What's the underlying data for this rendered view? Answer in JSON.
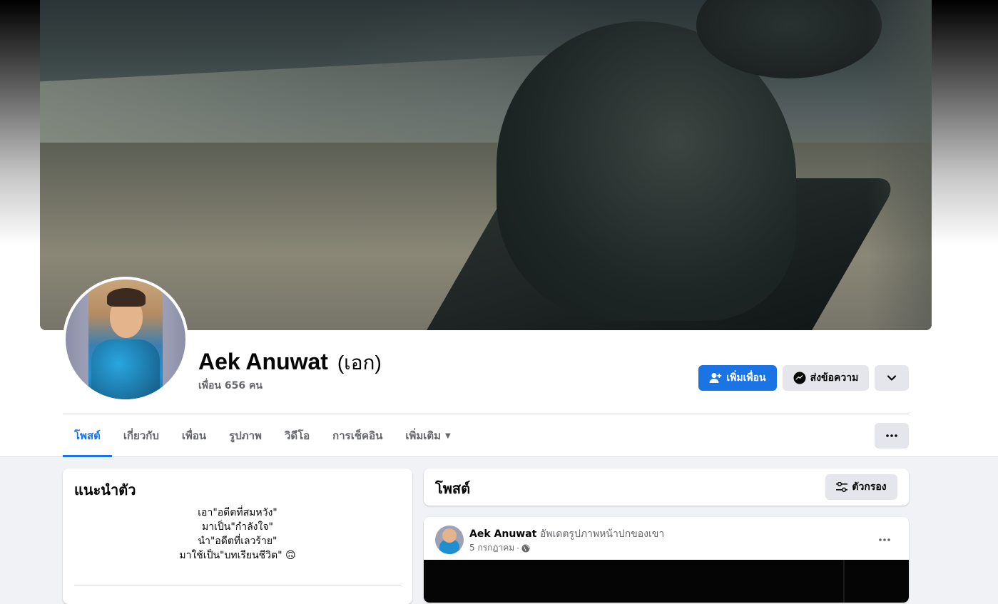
{
  "profile": {
    "name": "Aek Anuwat",
    "alt_name": "(เอก)",
    "friends": "เพื่อน 656 คน"
  },
  "actions": {
    "add_friend": "เพิ่มเพื่อน",
    "message": "ส่งข้อความ"
  },
  "tabs": [
    {
      "label": "โพสต์",
      "active": true
    },
    {
      "label": "เกี่ยวกับ"
    },
    {
      "label": "เพื่อน"
    },
    {
      "label": "รูปภาพ"
    },
    {
      "label": "วิดีโอ"
    },
    {
      "label": "การเช็คอิน"
    },
    {
      "label": "เพิ่มเติม"
    }
  ],
  "intro": {
    "title": "แนะนำตัว",
    "bio_lines": [
      "เอา\"อดีตที่สมหวัง\"",
      "มาเป็น\"กำลังใจ\"",
      "นำ\"อดีตที่เลวร้าย\"",
      "มาใช้เป็น\"บทเรียนชีวิต\" 🙃"
    ]
  },
  "posts": {
    "title": "โพสต์",
    "filter_label": "ตัวกรอง",
    "items": [
      {
        "author": "Aek Anuwat",
        "action": "อัพเดตรูปภาพหน้าปกของเขา",
        "date": "5 กรกฎาคม",
        "separator": "·",
        "privacy_icon": "globe-icon"
      }
    ]
  },
  "colors": {
    "accent": "#1b74e4",
    "secondary_button": "#e4e6eb",
    "page_bg": "#f0f2f5",
    "muted_text": "#65676b"
  }
}
